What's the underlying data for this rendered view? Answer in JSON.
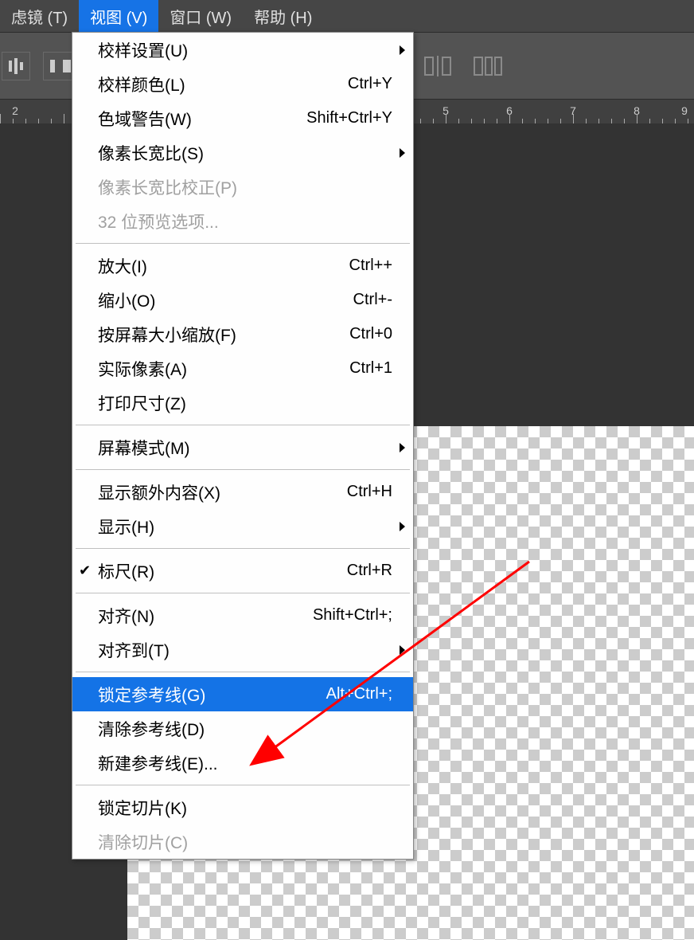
{
  "menubar": {
    "items": [
      {
        "label": "虑镜 (T)"
      },
      {
        "label": "视图 (V)"
      },
      {
        "label": "窗口 (W)"
      },
      {
        "label": "帮助 (H)"
      }
    ]
  },
  "ruler": {
    "numbers": [
      "2",
      "5",
      "6",
      "7",
      "8",
      "9"
    ]
  },
  "dropdown": {
    "groups": [
      [
        {
          "label": "校样设置(U)",
          "shortcut": "",
          "submenu": true,
          "disabled": false
        },
        {
          "label": "校样颜色(L)",
          "shortcut": "Ctrl+Y",
          "submenu": false,
          "disabled": false
        },
        {
          "label": "色域警告(W)",
          "shortcut": "Shift+Ctrl+Y",
          "submenu": false,
          "disabled": false
        },
        {
          "label": "像素长宽比(S)",
          "shortcut": "",
          "submenu": true,
          "disabled": false
        },
        {
          "label": "像素长宽比校正(P)",
          "shortcut": "",
          "submenu": false,
          "disabled": true
        },
        {
          "label": "32 位预览选项...",
          "shortcut": "",
          "submenu": false,
          "disabled": true
        }
      ],
      [
        {
          "label": "放大(I)",
          "shortcut": "Ctrl++",
          "submenu": false,
          "disabled": false
        },
        {
          "label": "缩小(O)",
          "shortcut": "Ctrl+-",
          "submenu": false,
          "disabled": false
        },
        {
          "label": "按屏幕大小缩放(F)",
          "shortcut": "Ctrl+0",
          "submenu": false,
          "disabled": false
        },
        {
          "label": "实际像素(A)",
          "shortcut": "Ctrl+1",
          "submenu": false,
          "disabled": false
        },
        {
          "label": "打印尺寸(Z)",
          "shortcut": "",
          "submenu": false,
          "disabled": false
        }
      ],
      [
        {
          "label": "屏幕模式(M)",
          "shortcut": "",
          "submenu": true,
          "disabled": false
        }
      ],
      [
        {
          "label": "显示额外内容(X)",
          "shortcut": "Ctrl+H",
          "submenu": false,
          "disabled": false
        },
        {
          "label": "显示(H)",
          "shortcut": "",
          "submenu": true,
          "disabled": false
        }
      ],
      [
        {
          "label": "标尺(R)",
          "shortcut": "Ctrl+R",
          "submenu": false,
          "disabled": false,
          "checked": true
        }
      ],
      [
        {
          "label": "对齐(N)",
          "shortcut": "Shift+Ctrl+;",
          "submenu": false,
          "disabled": false
        },
        {
          "label": "对齐到(T)",
          "shortcut": "",
          "submenu": true,
          "disabled": false
        }
      ],
      [
        {
          "label": "锁定参考线(G)",
          "shortcut": "Alt+Ctrl+;",
          "submenu": false,
          "disabled": false,
          "highlighted": true
        },
        {
          "label": "清除参考线(D)",
          "shortcut": "",
          "submenu": false,
          "disabled": false
        },
        {
          "label": "新建参考线(E)...",
          "shortcut": "",
          "submenu": false,
          "disabled": false
        }
      ],
      [
        {
          "label": "锁定切片(K)",
          "shortcut": "",
          "submenu": false,
          "disabled": false
        },
        {
          "label": "清除切片(C)",
          "shortcut": "",
          "submenu": false,
          "disabled": true
        }
      ]
    ]
  }
}
